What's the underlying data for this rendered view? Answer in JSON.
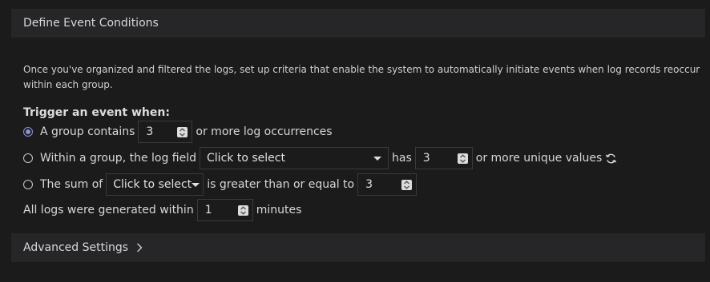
{
  "header": {
    "title": "Define Event Conditions"
  },
  "description": "Once you've organized and filtered the logs, set up criteria that enable the system to automatically initiate events when log records reoccur within each group.",
  "trigger_label": "Trigger an event when:",
  "options": {
    "group_contains": {
      "checked": true,
      "label_before": "A group contains",
      "value": "3",
      "label_after": "or more log occurrences"
    },
    "within_group": {
      "checked": false,
      "label_before": "Within a group, the log field",
      "select_value": "Click to select",
      "label_mid": "has",
      "value": "3",
      "label_after": "or more unique values",
      "icon": "refresh-icon"
    },
    "sum_of": {
      "checked": false,
      "label_before": "The sum of",
      "select_value": "Click to select",
      "label_mid": "is greater than or equal to",
      "value": "3"
    }
  },
  "generated_within": {
    "label_before": "All logs were generated within",
    "value": "1",
    "label_after": "minutes"
  },
  "advanced": {
    "label": "Advanced Settings",
    "icon": "chevron-right-icon"
  },
  "colors": {
    "background": "#1b1b1c",
    "panel": "#262628",
    "accent": "#8b93d8",
    "border": "#3a3a3c"
  }
}
